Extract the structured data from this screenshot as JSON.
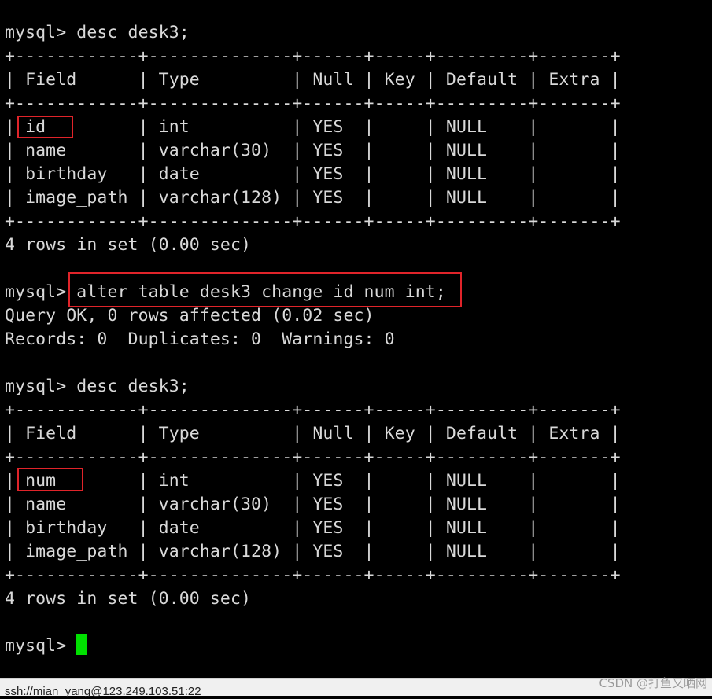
{
  "terminal": {
    "lines": [
      "mysql> desc desk3;",
      "+------------+--------------+------+-----+---------+-------+",
      "| Field      | Type         | Null | Key | Default | Extra |",
      "+------------+--------------+------+-----+---------+-------+",
      "| id         | int          | YES  |     | NULL    |       |",
      "| name       | varchar(30)  | YES  |     | NULL    |       |",
      "| birthday   | date         | YES  |     | NULL    |       |",
      "| image_path | varchar(128) | YES  |     | NULL    |       |",
      "+------------+--------------+------+-----+---------+-------+",
      "4 rows in set (0.00 sec)",
      "",
      "mysql> alter table desk3 change id num int;",
      "Query OK, 0 rows affected (0.02 sec)",
      "Records: 0  Duplicates: 0  Warnings: 0",
      "",
      "mysql> desc desk3;",
      "+------------+--------------+------+-----+---------+-------+",
      "| Field      | Type         | Null | Key | Default | Extra |",
      "+------------+--------------+------+-----+---------+-------+",
      "| num        | int          | YES  |     | NULL    |       |",
      "| name       | varchar(30)  | YES  |     | NULL    |       |",
      "| birthday   | date         | YES  |     | NULL    |       |",
      "| image_path | varchar(128) | YES  |     | NULL    |       |",
      "+------------+--------------+------+-----+---------+-------+",
      "4 rows in set (0.00 sec)",
      "",
      "mysql> "
    ],
    "text_color": "#d9d9d9",
    "background_color": "#000000",
    "cursor_color": "#00e000",
    "highlight_color": "#e0242a"
  },
  "status_bar": {
    "connection": "ssh://mian_yang@123.249.103.51:22"
  },
  "watermark": "CSDN @打鱼又晒网"
}
